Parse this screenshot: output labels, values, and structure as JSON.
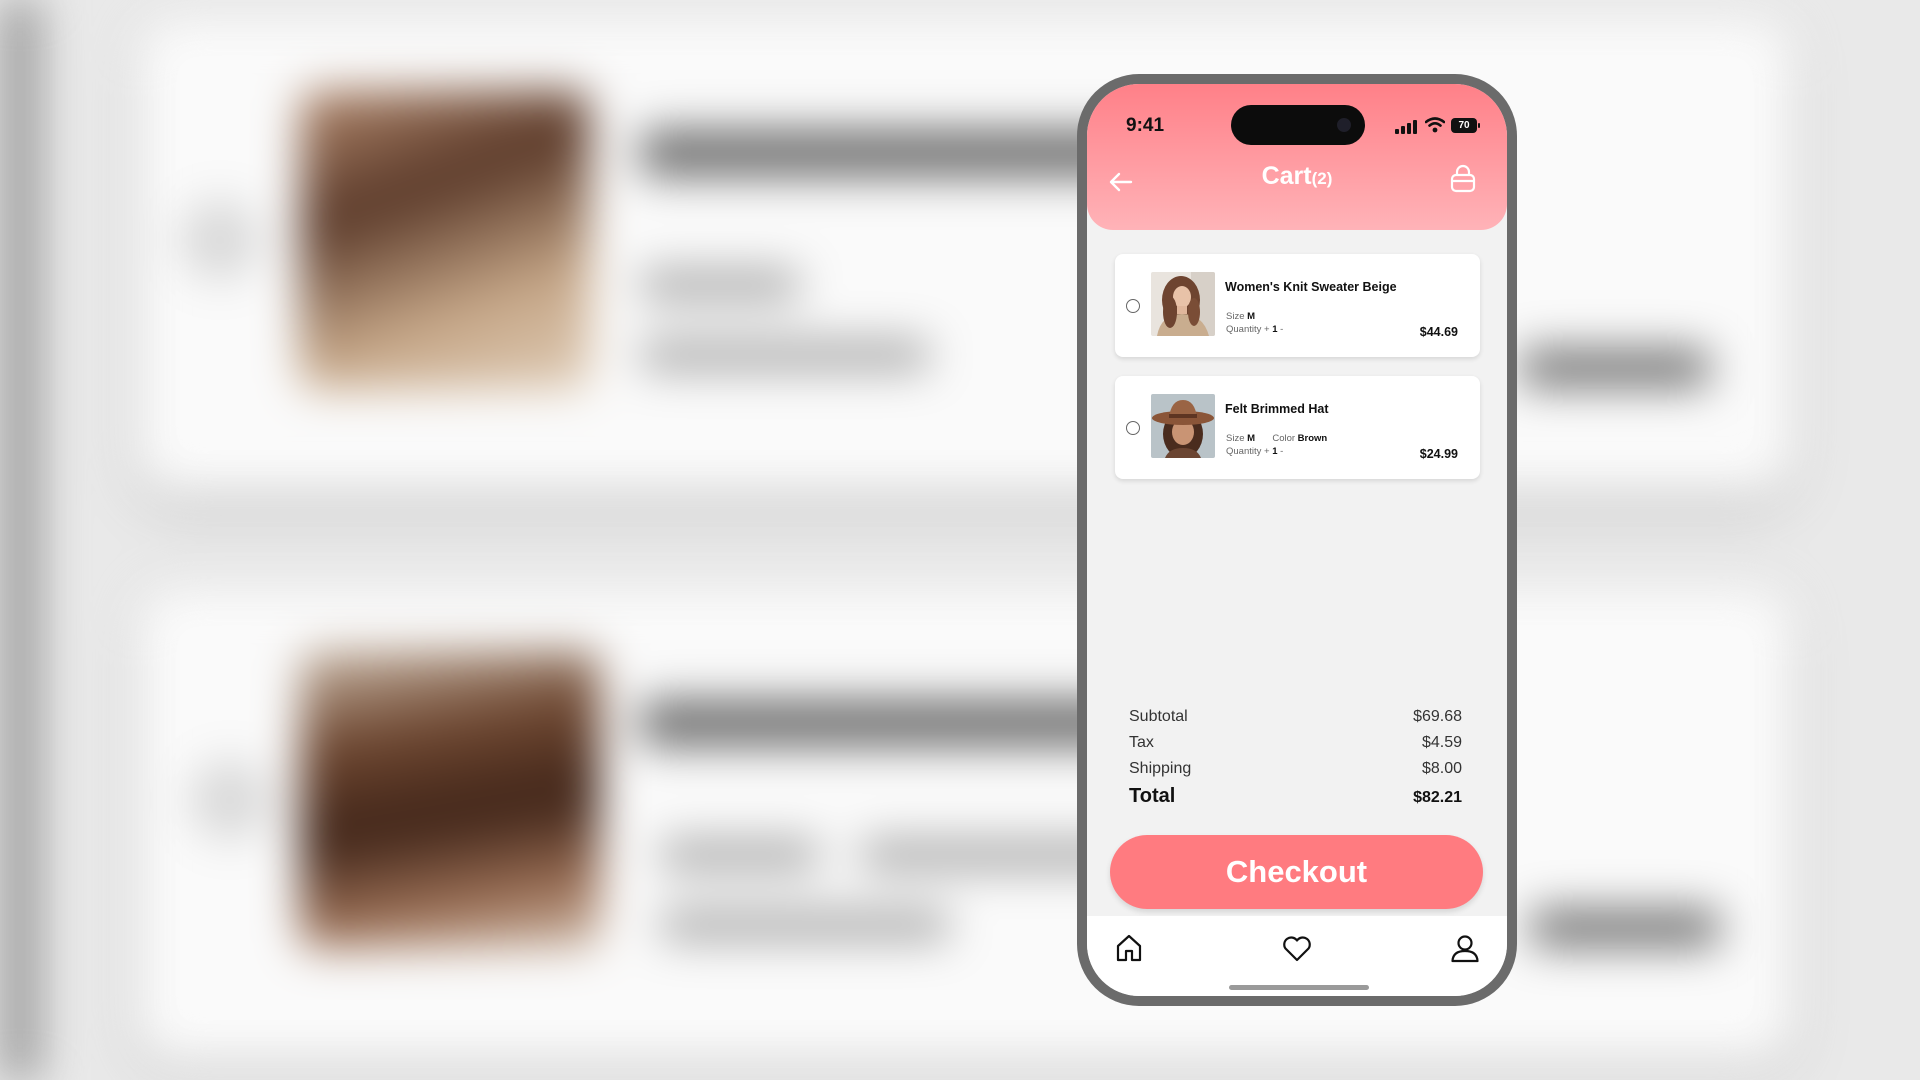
{
  "status_bar": {
    "time": "9:41",
    "battery": "70"
  },
  "header": {
    "title": "Cart",
    "count": "(2)"
  },
  "icons": {
    "back": "arrow-left-icon",
    "bag": "shopping-bag-icon",
    "signal": "cellular-signal-icon",
    "wifi": "wifi-icon",
    "battery": "battery-icon",
    "home": "home-icon",
    "favorites": "heart-icon",
    "profile": "user-icon"
  },
  "cart": {
    "items": [
      {
        "name": "Women's Knit Sweater Beige",
        "size_label": "Size",
        "size": "M",
        "quantity_label": "Quantity",
        "qty_plus": "+",
        "quantity": "1",
        "qty_minus": "-",
        "price": "$44.69"
      },
      {
        "name": "Felt Brimmed Hat",
        "size_label": "Size",
        "size": "M",
        "color_label": "Color",
        "color": "Brown",
        "quantity_label": "Quantity",
        "qty_plus": "+",
        "quantity": "1",
        "qty_minus": "-",
        "price": "$24.99"
      }
    ]
  },
  "summary": {
    "subtotal_label": "Subtotal",
    "subtotal": "$69.68",
    "tax_label": "Tax",
    "tax": "$4.59",
    "shipping_label": "Shipping",
    "shipping": "$8.00",
    "total_label": "Total",
    "total": "$82.21"
  },
  "checkout_label": "Checkout",
  "colors": {
    "accent": "#ff7b80",
    "header_top": "#ff8088",
    "header_bottom": "#ffb3b8",
    "phone_frame": "#6b6b6b"
  }
}
